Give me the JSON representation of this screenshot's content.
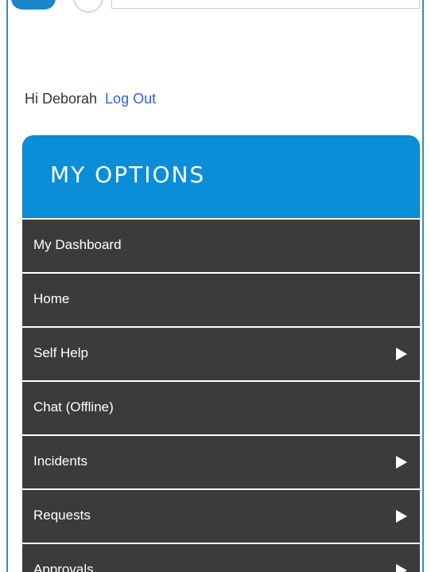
{
  "greeting": {
    "hello_text": "Hi Deborah",
    "logout_label": "Log Out"
  },
  "panel": {
    "title": "MY OPTIONS",
    "header_color": "#0a8ed8",
    "menu_bg_color": "#3b3b3b"
  },
  "menu": {
    "items": [
      {
        "label": "My Dashboard",
        "has_submenu": false
      },
      {
        "label": "Home",
        "has_submenu": false
      },
      {
        "label": "Self Help",
        "has_submenu": true,
        "icon": "triangle-right-icon"
      },
      {
        "label": "Chat (Offline)",
        "has_submenu": false
      },
      {
        "label": "Incidents",
        "has_submenu": true,
        "icon": "triangle-right-icon"
      },
      {
        "label": "Requests",
        "has_submenu": true,
        "icon": "triangle-right-icon"
      },
      {
        "label": "Approvals",
        "has_submenu": true,
        "icon": "triangle-right-icon"
      }
    ]
  }
}
